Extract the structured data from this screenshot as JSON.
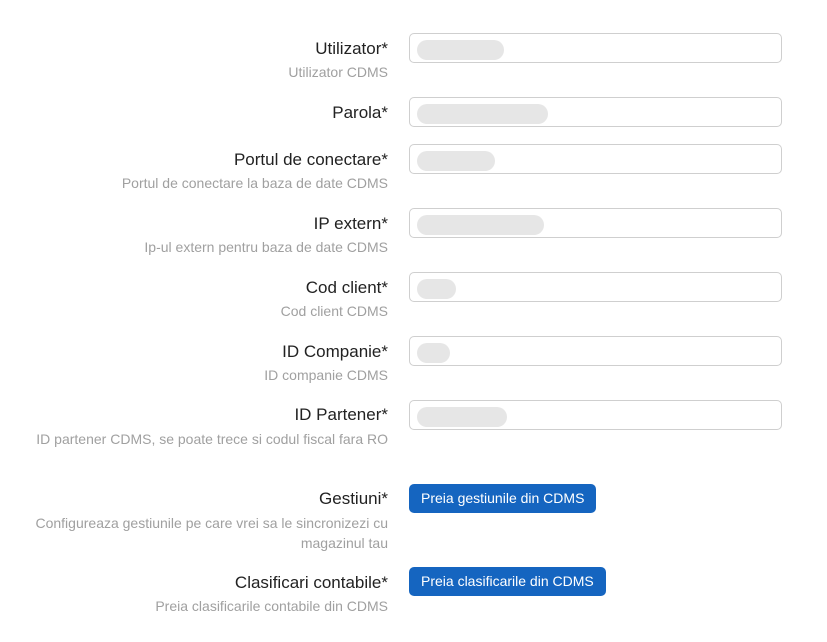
{
  "fields": [
    {
      "label": "Utilizator*",
      "hint": "Utilizator CDMS",
      "value": ""
    },
    {
      "label": "Parola*",
      "hint": "",
      "value": ""
    },
    {
      "label": "Portul de conectare*",
      "hint": "Portul de conectare la baza de date CDMS",
      "value": ""
    },
    {
      "label": "IP extern*",
      "hint": "Ip-ul extern pentru baza de date CDMS",
      "value": ""
    },
    {
      "label": "Cod client*",
      "hint": "Cod client CDMS",
      "value": ""
    },
    {
      "label": "ID Companie*",
      "hint": "ID companie CDMS",
      "value": ""
    },
    {
      "label": "ID Partener*",
      "hint": "ID partener CDMS, se poate trece si codul fiscal fara RO",
      "value": ""
    }
  ],
  "actions": [
    {
      "label": "Gestiuni*",
      "hint": "Configureaza gestiunile pe care vrei sa le sincronizezi cu magazinul tau",
      "button": "Preia gestiunile din CDMS"
    },
    {
      "label": "Clasificari contabile*",
      "hint": "Preia clasificarile contabile din CDMS",
      "button": "Preia clasificarile din CDMS"
    }
  ]
}
